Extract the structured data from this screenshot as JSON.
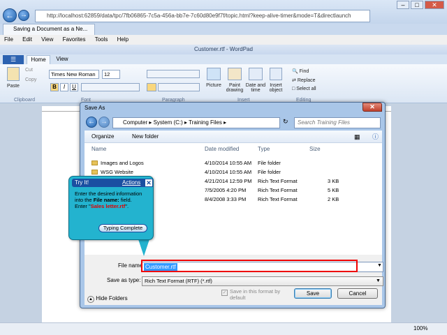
{
  "ie": {
    "address": "http://localhost:62859/data/tpc/7fb06865-7c5a-456a-bb7e-7c60d80e9f7f/topic.html?keep-alive-timer&mode=T&directlaunch",
    "address_host": "localhost",
    "tab_title": "Saving a Document as a Ne...",
    "menu": [
      "File",
      "Edit",
      "View",
      "Favorites",
      "Tools",
      "Help"
    ],
    "zoom": "100%"
  },
  "wordpad": {
    "title": "Customer.rtf - WordPad",
    "tabs": [
      "Home",
      "View"
    ],
    "font_name": "Times New Roman",
    "font_size": "12",
    "clipboard": {
      "paste": "Paste",
      "cut": "Cut",
      "copy": "Copy",
      "group": "Clipboard"
    },
    "groups": {
      "font": "Font",
      "paragraph": "Paragraph",
      "insert": "Insert",
      "editing": "Editing"
    },
    "insert": {
      "picture": "Picture",
      "paint": "Paint drawing",
      "datetime": "Date and time",
      "object": "Insert object"
    },
    "editing": {
      "find": "Find",
      "replace": "Replace",
      "select_all": "Select all"
    }
  },
  "dialog": {
    "title": "Save As",
    "breadcrumb": [
      "Computer",
      "System (C:)",
      "Training Files"
    ],
    "search_placeholder": "Search Training Files",
    "toolbar": {
      "organize": "Organize",
      "new_folder": "New folder"
    },
    "columns": [
      "Name",
      "Date modified",
      "Type",
      "Size"
    ],
    "files": [
      {
        "name": "Images and Logos",
        "date": "4/10/2014 10:55 AM",
        "type": "File folder",
        "size": ""
      },
      {
        "name": "WSG Website",
        "date": "4/10/2014 10:55 AM",
        "type": "File folder",
        "size": ""
      },
      {
        "name": "",
        "date": "4/21/2014 12:59 PM",
        "type": "Rich Text Format",
        "size": "3 KB"
      },
      {
        "name": "",
        "date": "7/5/2005 4:20 PM",
        "type": "Rich Text Format",
        "size": "5 KB"
      },
      {
        "name": "",
        "date": "8/4/2008 3:33 PM",
        "type": "Rich Text Format",
        "size": "2 KB"
      }
    ],
    "file_name_label": "File name:",
    "file_name_value": "Customer.rtf",
    "save_as_type_label": "Save as type:",
    "save_as_type_value": "Rich Text Format (RTF) (*.rtf)",
    "save_format_checkbox": "Save in this format by default",
    "hide_folders": "Hide Folders",
    "save_button": "Save",
    "cancel_button": "Cancel"
  },
  "tip": {
    "title": "Try It!",
    "actions": "Actions",
    "line1": "Enter the desired information into the ",
    "field": "File name:",
    "line2": " field.",
    "line3": "Enter \"",
    "value": "Sales letter.rtf",
    "line4": "\".",
    "button": "Typing Complete"
  },
  "colors": {
    "accent": "#1a4fa1",
    "tip_bg": "#23b3cf",
    "highlight_red": "#e00000"
  }
}
